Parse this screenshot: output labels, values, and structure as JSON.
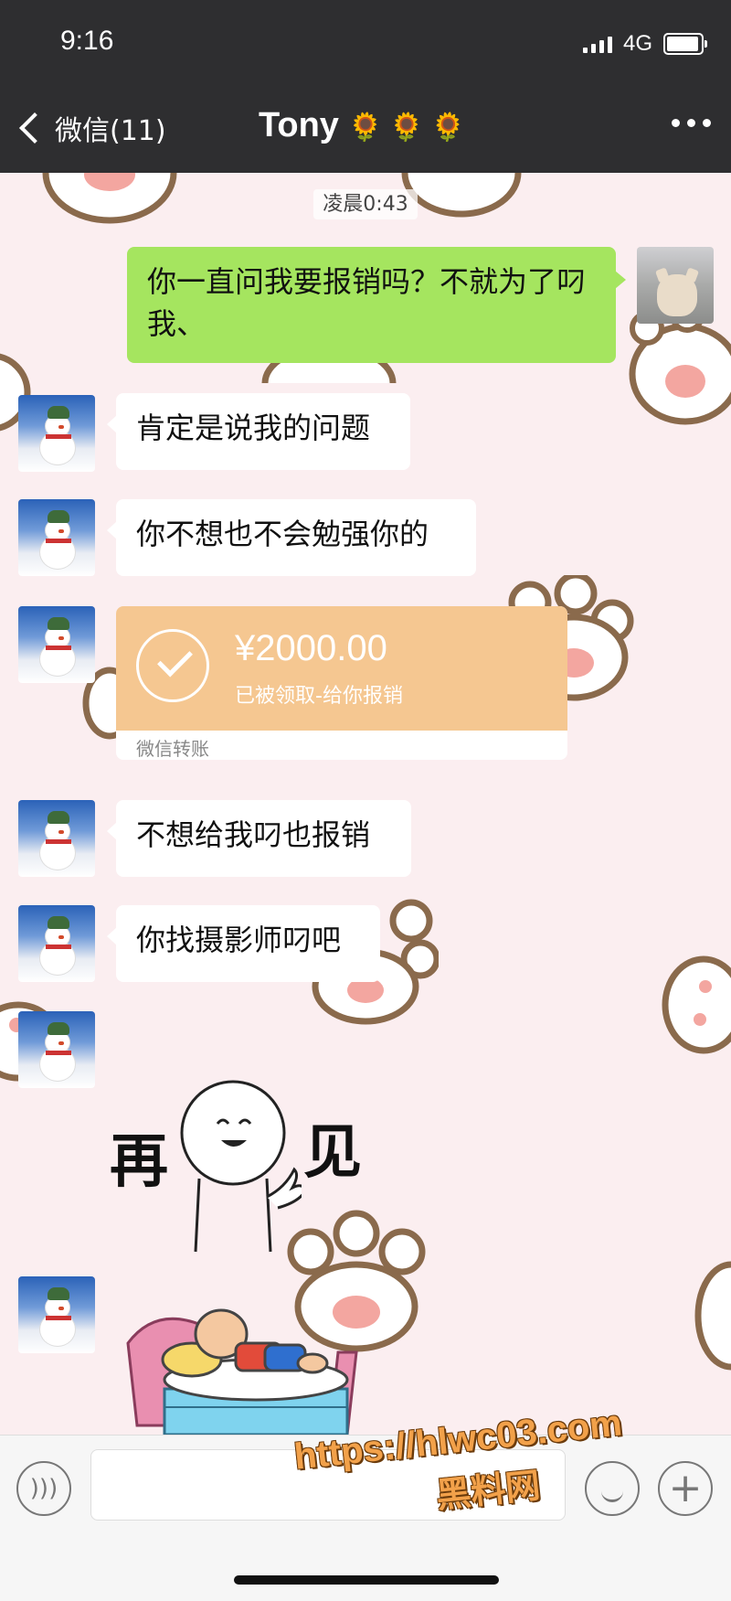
{
  "status_bar": {
    "time": "9:16",
    "network": "4G"
  },
  "nav": {
    "back_label": "微信(11)",
    "title": "Tony",
    "title_emoji": "🌻🌻🌻"
  },
  "chat": {
    "timestamp": "凌晨0:43",
    "messages": [
      {
        "side": "right",
        "text": "你一直问我要报销吗？不就为了叼我、"
      },
      {
        "side": "left",
        "text": "肯定是说我的问题"
      },
      {
        "side": "left",
        "text": "你不想也不会勉强你的"
      },
      {
        "side": "left",
        "type": "transfer",
        "amount": "¥2000.00",
        "note": "已被领取-给你报销",
        "footer": "微信转账"
      },
      {
        "side": "left",
        "text": "不想给我叼也报销"
      },
      {
        "side": "left",
        "text": "你找摄影师叼吧"
      },
      {
        "side": "left",
        "type": "sticker",
        "sticker_text_1": "再",
        "sticker_text_2": "见"
      },
      {
        "side": "left",
        "type": "sticker",
        "sticker_name": "sleeping-on-bed"
      }
    ]
  },
  "input_bar": {
    "placeholder": ""
  },
  "watermark": {
    "url": "https://hlwc03.com",
    "name": "黑料网"
  },
  "colors": {
    "topbar": "#2e2e30",
    "sent_bubble": "#a5e55f",
    "transfer": "#f5c791",
    "background": "#fbeef0"
  }
}
